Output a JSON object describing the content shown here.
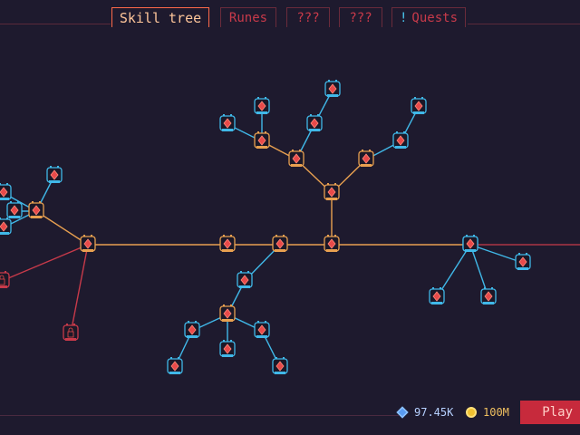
{
  "tabs": [
    {
      "label": "Skill tree",
      "active": true
    },
    {
      "label": "Runes",
      "active": false
    },
    {
      "label": "???",
      "active": false
    },
    {
      "label": "???",
      "active": false
    },
    {
      "label": "Quests",
      "active": false,
      "alert": "!"
    }
  ],
  "currencies": {
    "gems": {
      "value": "97.45K",
      "icon": "blue-gem-icon"
    },
    "gold": {
      "value": "100M",
      "icon": "gold-coin-icon"
    }
  },
  "play_button": {
    "label": "Play"
  },
  "colors": {
    "background": "#1e1a2e",
    "unlocked_path": "#e8a050",
    "available_path": "#40b8e8",
    "locked_path": "#c83a4a",
    "accent": "#ff6a4a"
  },
  "skill_tree": {
    "nodes": [
      {
        "id": "root",
        "state": "unlocked",
        "icon": "sword-icon"
      },
      {
        "id": "n-mid1",
        "state": "unlocked",
        "icon": "fist-icon"
      },
      {
        "id": "n-mid2",
        "state": "unlocked",
        "icon": "heart-icon"
      },
      {
        "id": "n-mid3",
        "state": "available",
        "icon": "skull-icon"
      },
      {
        "id": "n-up1",
        "state": "unlocked",
        "icon": "blade-icon"
      },
      {
        "id": "n-up-left",
        "state": "unlocked",
        "icon": "flame-icon"
      },
      {
        "id": "n-up-right",
        "state": "unlocked",
        "icon": "claw-icon"
      },
      {
        "id": "n-ul-a",
        "state": "unlocked",
        "icon": "fire-icon"
      },
      {
        "id": "n-ul-b",
        "state": "available",
        "icon": "potion-icon"
      },
      {
        "id": "n-ul-c",
        "state": "available",
        "icon": "bomb-icon"
      },
      {
        "id": "n-ul-d",
        "state": "available",
        "icon": "crosshair-icon"
      },
      {
        "id": "n-ul-e",
        "state": "available",
        "icon": "spear-icon"
      },
      {
        "id": "n-ur-a",
        "state": "available",
        "icon": "gem-icon"
      },
      {
        "id": "n-ur-b",
        "state": "available",
        "icon": "bottle-icon"
      },
      {
        "id": "n-left-hub",
        "state": "unlocked",
        "icon": "shield-icon"
      },
      {
        "id": "n-left-a",
        "state": "unlocked",
        "icon": "wing-icon"
      },
      {
        "id": "n-left-b",
        "state": "available",
        "icon": "bolt-icon"
      },
      {
        "id": "n-left-c",
        "state": "available",
        "icon": "star-icon"
      },
      {
        "id": "n-left-d",
        "state": "available",
        "icon": "drop-icon"
      },
      {
        "id": "n-left-e",
        "state": "available",
        "icon": "eye-icon"
      },
      {
        "id": "n-left-lock1",
        "state": "locked",
        "icon": "lock-icon"
      },
      {
        "id": "n-left-lock2",
        "state": "locked",
        "icon": "lock-icon"
      },
      {
        "id": "n-down1",
        "state": "available",
        "icon": "flask-icon"
      },
      {
        "id": "n-down2",
        "state": "unlocked",
        "icon": "spark-icon"
      },
      {
        "id": "n-down-a",
        "state": "available",
        "icon": "mushroom-icon"
      },
      {
        "id": "n-down-b",
        "state": "available",
        "icon": "rose-icon"
      },
      {
        "id": "n-down-c",
        "state": "available",
        "icon": "dagger-icon"
      },
      {
        "id": "n-down-d",
        "state": "available",
        "icon": "crown-icon"
      },
      {
        "id": "n-down-e",
        "state": "available",
        "icon": "axe-icon"
      },
      {
        "id": "n-right-hub",
        "state": "available",
        "icon": "orb-icon"
      },
      {
        "id": "n-right-a",
        "state": "available",
        "icon": "moon-icon"
      },
      {
        "id": "n-right-b",
        "state": "available",
        "icon": "ember-icon"
      },
      {
        "id": "n-right-c",
        "state": "available",
        "icon": "rune-icon"
      }
    ],
    "edges": [
      {
        "from": "root",
        "to": "n-mid3",
        "state": "unlocked"
      },
      {
        "from": "root",
        "to": "n-up1",
        "state": "unlocked"
      },
      {
        "from": "n-up1",
        "to": "n-up-left",
        "state": "unlocked"
      },
      {
        "from": "n-up1",
        "to": "n-up-right",
        "state": "unlocked"
      },
      {
        "from": "n-up-left",
        "to": "n-ul-a",
        "state": "unlocked"
      },
      {
        "from": "n-ul-a",
        "to": "n-ul-b",
        "state": "available"
      },
      {
        "from": "n-ul-a",
        "to": "n-ul-c",
        "state": "available"
      },
      {
        "from": "n-up-left",
        "to": "n-ul-d",
        "state": "available"
      },
      {
        "from": "n-ul-d",
        "to": "n-ul-e",
        "state": "available"
      },
      {
        "from": "n-up-right",
        "to": "n-ur-a",
        "state": "available"
      },
      {
        "from": "n-ur-a",
        "to": "n-ur-b",
        "state": "available"
      },
      {
        "from": "n-mid1",
        "to": "n-mid2",
        "state": "unlocked"
      },
      {
        "from": "n-mid2",
        "to": "root",
        "state": "unlocked"
      },
      {
        "from": "n-left-hub",
        "to": "n-mid1",
        "state": "unlocked"
      },
      {
        "from": "n-left-hub",
        "to": "n-left-a",
        "state": "unlocked"
      },
      {
        "from": "n-left-a",
        "to": "n-left-b",
        "state": "available"
      },
      {
        "from": "n-left-a",
        "to": "n-left-c",
        "state": "available"
      },
      {
        "from": "n-left-a",
        "to": "n-left-d",
        "state": "available"
      },
      {
        "from": "n-left-a",
        "to": "n-left-e",
        "state": "available"
      },
      {
        "from": "n-left-hub",
        "to": "n-left-lock1",
        "state": "locked"
      },
      {
        "from": "n-left-hub",
        "to": "n-left-lock2",
        "state": "locked"
      },
      {
        "from": "n-mid2",
        "to": "n-down1",
        "state": "available"
      },
      {
        "from": "n-down1",
        "to": "n-down2",
        "state": "available"
      },
      {
        "from": "n-down2",
        "to": "n-down-a",
        "state": "available"
      },
      {
        "from": "n-down-a",
        "to": "n-down-b",
        "state": "available"
      },
      {
        "from": "n-down2",
        "to": "n-down-c",
        "state": "available"
      },
      {
        "from": "n-down2",
        "to": "n-down-d",
        "state": "available"
      },
      {
        "from": "n-down-d",
        "to": "n-down-e",
        "state": "available"
      },
      {
        "from": "n-mid3",
        "to": "n-right-hub",
        "state": "unlocked"
      },
      {
        "from": "n-right-hub",
        "to": "n-right-a",
        "state": "available"
      },
      {
        "from": "n-right-hub",
        "to": "n-right-b",
        "state": "available"
      },
      {
        "from": "n-right-hub",
        "to": "n-right-c",
        "state": "available"
      }
    ]
  }
}
